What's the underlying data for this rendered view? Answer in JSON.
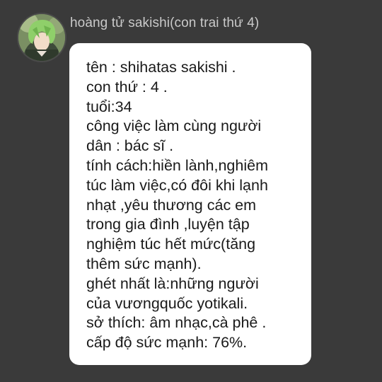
{
  "sender": {
    "name": "hoàng tử sakishi(con trai thứ 4)",
    "avatar_icon": "profile-avatar-anime-green-hair"
  },
  "message": {
    "lines": [
      "tên : shihatas sakishi .",
      "con thứ : 4 .",
      "tuổi:34",
      "công việc làm cùng người",
      "dân : bác sĩ .",
      "tính cách:hiền lành,nghiêm",
      "túc làm việc,có đôi khi lạnh",
      "nhạt ,yêu thương các em",
      "trong gia đình ,luyện tập",
      "nghiệm túc hết mức(tăng",
      "thêm sức mạnh).",
      "ghét nhất là:những người",
      "của vươngquốc yotikali.",
      "sở thích: âm nhạc,cà phê .",
      "cấp độ sức mạnh: 76%."
    ]
  },
  "colors": {
    "background": "#3a3a3a",
    "bubble": "#ffffff",
    "sender_name": "#c9c9c9",
    "message_text": "#1a1a1a"
  }
}
